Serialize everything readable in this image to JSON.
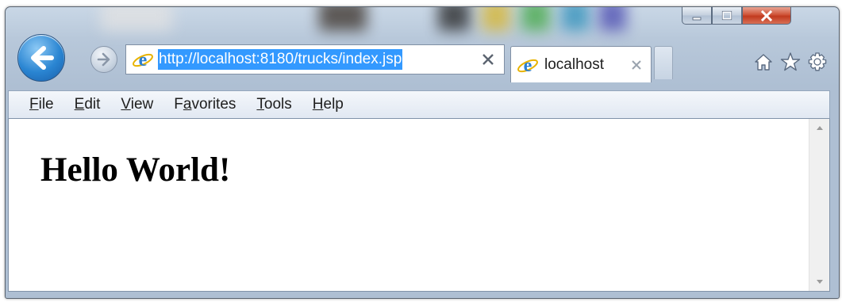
{
  "browser": {
    "address_url": "http://localhost:8180/trucks/index.jsp",
    "tab_title": "localhost"
  },
  "menubar": {
    "items": [
      {
        "key": "F",
        "rest": "ile"
      },
      {
        "key": "E",
        "rest": "dit"
      },
      {
        "key": "V",
        "rest": "iew"
      },
      {
        "pre": "F",
        "key": "a",
        "rest": "vorites"
      },
      {
        "key": "T",
        "rest": "ools"
      },
      {
        "key": "H",
        "rest": "elp"
      }
    ]
  },
  "page": {
    "heading": "Hello World!"
  },
  "icons": {
    "back": "back-arrow-icon",
    "forward": "forward-arrow-icon",
    "ie": "ie-logo-icon",
    "stop": "close-icon",
    "home": "home-icon",
    "favorites": "star-icon",
    "tools": "gear-icon"
  },
  "colors": {
    "selection": "#3399ff",
    "close_button": "#c13a1f",
    "back_button": "#2a85d2"
  }
}
